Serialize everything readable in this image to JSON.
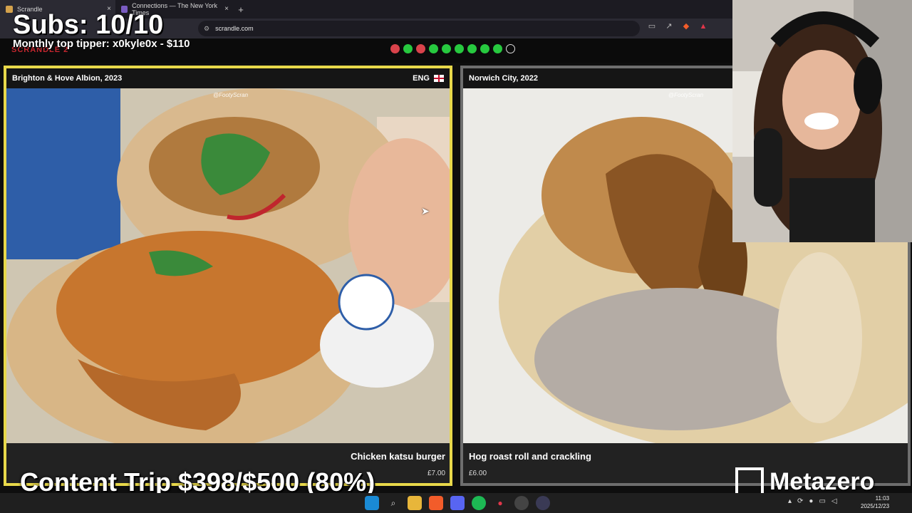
{
  "browser": {
    "tabs": [
      {
        "label": "Scrandle",
        "active": true
      },
      {
        "label": "Connections — The New York Times",
        "active": false
      }
    ],
    "new_tab_glyph": "+",
    "close_glyph": "×",
    "url": "scrandle.com"
  },
  "game": {
    "brand": "SCRANDLE 2",
    "progress": [
      "red",
      "green",
      "red",
      "green",
      "green",
      "green",
      "green",
      "green",
      "green",
      "empty"
    ],
    "colors": {
      "green": "#27c93f",
      "red": "#d9434b",
      "empty": "transparent",
      "left_border": "#e8d84a",
      "right_border": "#6e6e6e"
    },
    "left_card": {
      "club": "Brighton & Hove Albion, 2023",
      "country": "ENG",
      "credit": "@FootyScran",
      "dish": "Chicken katsu burger",
      "price": "£7.00"
    },
    "right_card": {
      "club": "Norwich City, 2022",
      "credit": "@FootyScran",
      "dish": "Hog roast roll and crackling",
      "price": "£6.00"
    }
  },
  "stream_overlay": {
    "subs": "Subs: 10/10",
    "top_tipper": "Monthly top tipper: x0kyle0x - $110",
    "content_trip": "Content Trip $398/$500 (80%)",
    "sponsor": "Metazero"
  },
  "taskbar": {
    "time": "11:03",
    "date": "2025/12/23",
    "icons": [
      "windows-icon",
      "search-icon",
      "file-explorer-icon",
      "brave-icon",
      "discord-icon",
      "spotify-icon",
      "maps-icon",
      "chrome-icon",
      "obs-icon"
    ]
  }
}
